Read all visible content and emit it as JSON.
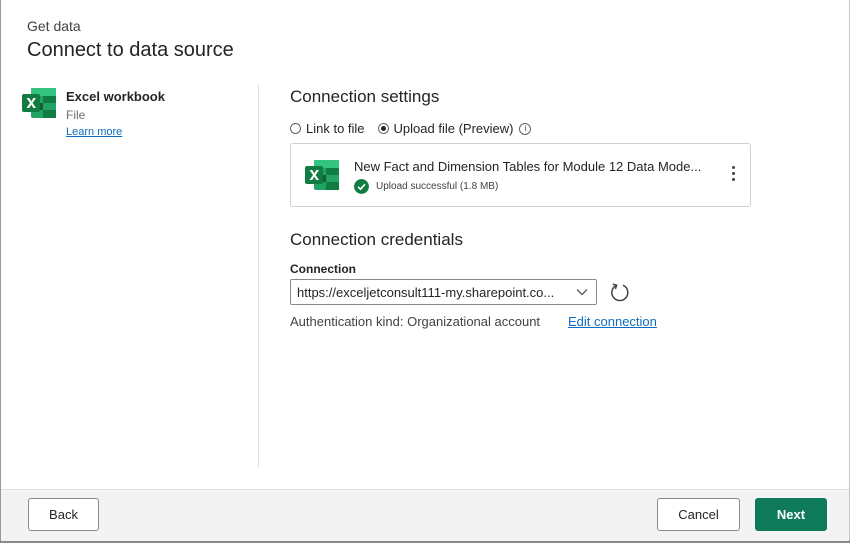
{
  "header": {
    "subtitle": "Get data",
    "title": "Connect to data source"
  },
  "sidebar": {
    "connector_name": "Excel workbook",
    "category": "File",
    "learn_more": "Learn more"
  },
  "connection_settings": {
    "title": "Connection settings",
    "options": [
      {
        "label": "Link to file",
        "selected": false
      },
      {
        "label": "Upload file (Preview)",
        "selected": true
      }
    ],
    "file": {
      "name": "New Fact and Dimension Tables for Module 12 Data Mode...",
      "status": "Upload successful (1.8 MB)"
    }
  },
  "connection_credentials": {
    "title": "Connection credentials",
    "connection_label": "Connection",
    "connection_value": "https://exceljetconsult111-my.sharepoint.co...",
    "auth_text": "Authentication kind: Organizational account",
    "edit_link": "Edit connection"
  },
  "footer": {
    "back": "Back",
    "cancel": "Cancel",
    "next": "Next"
  },
  "colors": {
    "accent": "#0e7a5a",
    "link": "#0f6cbd",
    "success": "#107c41",
    "excel": "#107c41"
  },
  "icons": [
    "excel-icon",
    "info-icon",
    "check-circle-icon",
    "more-vertical-icon",
    "chevron-down-icon",
    "refresh-icon"
  ]
}
